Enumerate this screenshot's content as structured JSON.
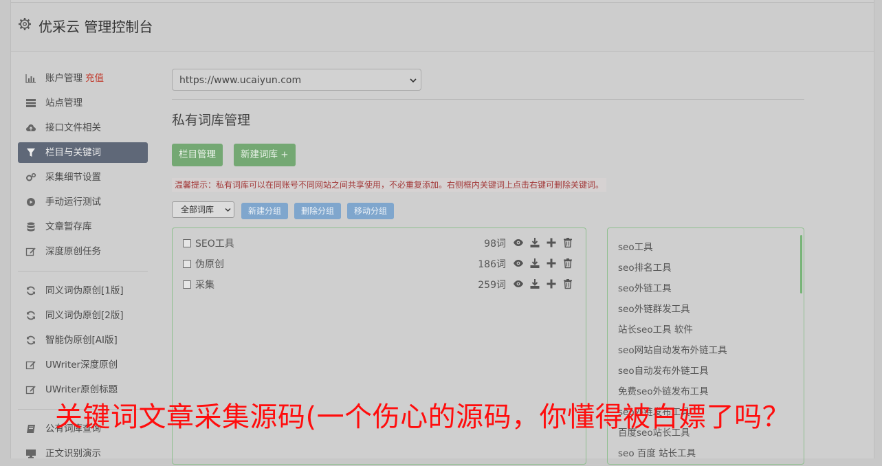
{
  "header": {
    "title": "优采云 管理控制台",
    "icon": "gear-icon"
  },
  "sidebar": {
    "group1": [
      {
        "label": "账户管理",
        "badge": "充值",
        "icon": "bar-chart-icon"
      },
      {
        "label": "站点管理",
        "icon": "server-icon"
      },
      {
        "label": "接口文件相关",
        "icon": "cloud-upload-icon"
      },
      {
        "label": "栏目与关键词",
        "icon": "filter-icon",
        "active": true
      },
      {
        "label": "采集细节设置",
        "icon": "gears-icon"
      },
      {
        "label": "手动运行测试",
        "icon": "play-circle-icon"
      },
      {
        "label": "文章暂存库",
        "icon": "database-icon"
      },
      {
        "label": "深度原创任务",
        "icon": "edit-icon"
      }
    ],
    "group2": [
      {
        "label": "同义词伪原创[1版]",
        "icon": "refresh-icon"
      },
      {
        "label": "同义词伪原创[2版]",
        "icon": "refresh-icon"
      },
      {
        "label": "智能伪原创[AI版]",
        "icon": "refresh-icon"
      },
      {
        "label": "UWriter深度原创",
        "icon": "edit-icon"
      },
      {
        "label": "UWriter原创标题",
        "icon": "edit-icon"
      }
    ],
    "group3": [
      {
        "label": "公有词库查询",
        "icon": "book-icon"
      },
      {
        "label": "正文识别演示",
        "icon": "monitor-icon"
      }
    ]
  },
  "main": {
    "site_select": {
      "value": "https://www.ucaiyun.com"
    },
    "page_title": "私有词库管理",
    "buttons": {
      "column_manage": "栏目管理",
      "new_library": "新建词库 +"
    },
    "tip": "温馨提示：私有词库可以在同账号不同网站之间共享使用，不必重复添加。右侧框内关键词上点击右键可删除关键词。",
    "group_select": {
      "value": "全部词库"
    },
    "group_buttons": {
      "new_group": "新建分组",
      "delete_group": "删除分组",
      "move_group": "移动分组"
    },
    "libraries": [
      {
        "name": "SEO工具",
        "count": "98词"
      },
      {
        "name": "伪原创",
        "count": "186词"
      },
      {
        "name": "采集",
        "count": "259词"
      }
    ],
    "keywords": [
      "seo工具",
      "seo排名工具",
      "seo外链工具",
      "seo外链群发工具",
      "站长seo工具 软件",
      "seo网站自动发布外链工具",
      "seo自动发布外链工具",
      "免费seo外链发布工具",
      "seo外链发布工具",
      "百度seo站长工具",
      "seo 百度 站长工具"
    ]
  },
  "overlay": {
    "title": "关键词文章采集源码(一个伤心的源码，你懂得被白嫖了吗？"
  },
  "colors": {
    "active_nav": "#5f6878",
    "green_button": "#74a873",
    "blue_button": "#7fa6cd",
    "overlay_red": "#ff0d0d",
    "tip_red": "#a33a3a"
  }
}
